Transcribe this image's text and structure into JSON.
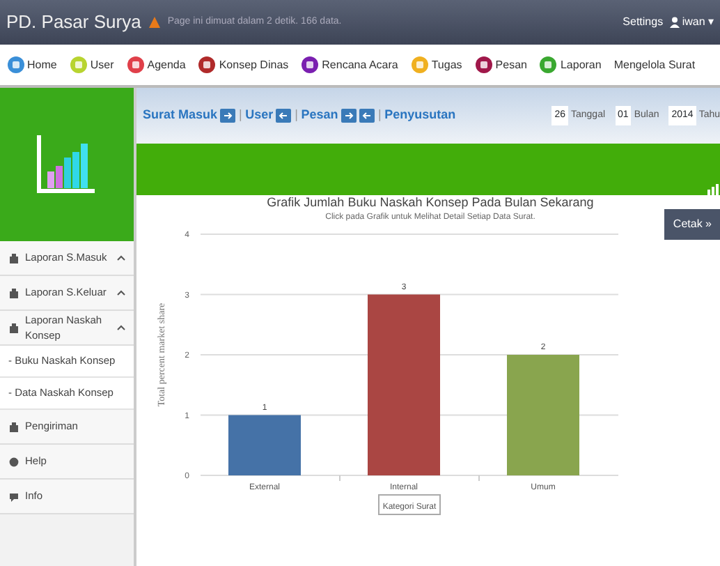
{
  "header": {
    "brand": "PD. Pasar Surya",
    "info": "Page ini dimuat dalam 2 detik. 166 data.",
    "settings": "Settings",
    "user": "iwan",
    "user_caret": "▾"
  },
  "menu": [
    {
      "label": "Home",
      "color": "#3a8fd8"
    },
    {
      "label": "User",
      "color": "#b8d430"
    },
    {
      "label": "Agenda",
      "color": "#e0404a"
    },
    {
      "label": "Konsep Dinas",
      "color": "#b02a2a"
    },
    {
      "label": "Rencana Acara",
      "color": "#7a1fb0"
    },
    {
      "label": "Tugas",
      "color": "#f0b020"
    },
    {
      "label": "Pesan",
      "color": "#a0184a"
    },
    {
      "label": "Laporan",
      "color": "#3aa830"
    },
    {
      "label": "Mengelola Surat"
    }
  ],
  "sidebar": {
    "items": [
      {
        "label": "Laporan S.Masuk",
        "kind": "group"
      },
      {
        "label": "Laporan S.Keluar",
        "kind": "group"
      },
      {
        "label": "Laporan Naskah Konsep",
        "kind": "group",
        "children": [
          {
            "label": "- Buku Naskah Konsep"
          },
          {
            "label": "- Data Naskah Konsep"
          }
        ]
      },
      {
        "label": "Pengiriman",
        "kind": "plain"
      },
      {
        "label": "Help",
        "kind": "help"
      },
      {
        "label": "Info",
        "kind": "info"
      }
    ]
  },
  "breadcrumb": [
    {
      "label": "Surat Masuk",
      "icons": [
        {
          "kind": "in"
        }
      ]
    },
    {
      "separator": "|",
      "label": "User",
      "icons": [
        {
          "kind": "out"
        }
      ]
    },
    {
      "separator": "|",
      "label": "Pesan",
      "icons": [
        {
          "kind": "in"
        },
        {
          "kind": "out"
        }
      ]
    },
    {
      "separator": "|",
      "label": "Penyusutan"
    }
  ],
  "date": {
    "day": "26",
    "day_unit": "Tanggal",
    "month": "01",
    "month_unit": "Bulan",
    "year": "2014",
    "year_unit": "Tahu"
  },
  "print_button": "Cetak »",
  "chart": {
    "chart_data": {
      "type": "bar",
      "title": "Grafik Jumlah Buku Naskah Konsep Pada Bulan Sekarang",
      "subtitle": "Click pada Grafik untuk Melihat Detail Setiap Data Surat.",
      "xlabel": "Kategori Surat",
      "ylabel": "Total percent market share",
      "categories": [
        "External",
        "Internal",
        "Umum"
      ],
      "series": [
        {
          "colors": [
            "#4572a7",
            "#aa4643",
            "#89a54e"
          ],
          "values": [
            1,
            3,
            2
          ]
        }
      ],
      "ylim": [
        0,
        4
      ],
      "yticks": [
        0,
        1,
        2,
        3,
        4
      ],
      "grid": true,
      "data_labels": true
    }
  }
}
